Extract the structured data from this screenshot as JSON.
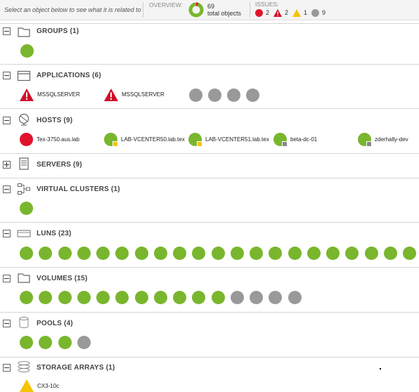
{
  "header": {
    "hint": "Select an object below to see what it is related to",
    "overview_label": "OVERVIEW:",
    "total_count": "69",
    "total_label": "total objects",
    "issues_label": "ISSUES:",
    "issues": [
      {
        "type": "critical",
        "count": "2",
        "icon": "red-circle-icon"
      },
      {
        "type": "error",
        "count": "2",
        "icon": "red-triangle-icon"
      },
      {
        "type": "warning",
        "count": "1",
        "icon": "yellow-triangle-icon"
      },
      {
        "type": "unknown",
        "count": "9",
        "icon": "gray-circle-icon"
      }
    ]
  },
  "sections": {
    "groups": {
      "title": "GROUPS (1)",
      "expanded": true,
      "icon": "folder-icon"
    },
    "applications": {
      "title": "APPLICATIONS (6)",
      "expanded": true,
      "icon": "window-icon",
      "items": [
        "MSSQLSERVER",
        "MSSQLSERVER"
      ]
    },
    "hosts": {
      "title": "HOSTS (9)",
      "expanded": true,
      "icon": "host-icon",
      "items": [
        "Tex-3750.aus.lab",
        "LAB-VCENTER50.lab.tex",
        "LAB-VCENTER51.lab.tex",
        "beta-dc-01",
        "zderhally-dev"
      ]
    },
    "servers": {
      "title": "SERVERS (9)",
      "expanded": false,
      "icon": "server-icon"
    },
    "virtual_clusters": {
      "title": "VIRTUAL CLUSTERS (1)",
      "expanded": true,
      "icon": "cluster-icon"
    },
    "luns": {
      "title": "LUNS (23)",
      "expanded": true,
      "icon": "lun-icon"
    },
    "volumes": {
      "title": "VOLUMES (15)",
      "expanded": true,
      "icon": "folder-icon"
    },
    "pools": {
      "title": "POOLS (4)",
      "expanded": true,
      "icon": "pool-icon"
    },
    "storage_arrays": {
      "title": "STORAGE ARRAYS (1)",
      "expanded": true,
      "icon": "storage-icon",
      "items": [
        "CX3-10c"
      ]
    }
  },
  "colors": {
    "ok": "#79b62d",
    "unknown": "#999999",
    "critical": "#e0142d",
    "warning": "#f5c400"
  }
}
